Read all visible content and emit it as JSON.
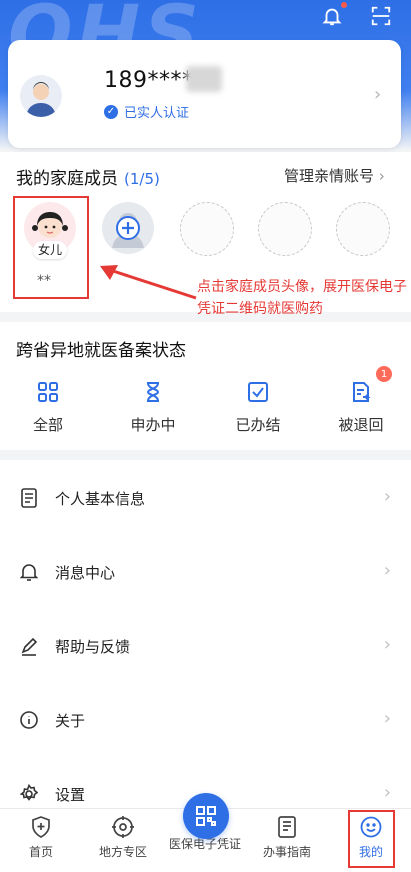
{
  "header": {
    "logo_text": "QHS"
  },
  "top_icons": [
    "bell-icon",
    "scan-icon"
  ],
  "user": {
    "phone": "189****",
    "verify_label": "已实人认证"
  },
  "family": {
    "title": "我的家庭成员",
    "count": "(1/5)",
    "manage_label": "管理亲情账号",
    "member_tag": "女儿",
    "member_name": "**"
  },
  "annotation": "点击家庭成员头像，展开医保电子凭证二维码就医购药",
  "records": {
    "title": "跨省异地就医备案状态",
    "items": [
      "全部",
      "申办中",
      "已办结",
      "被退回"
    ],
    "badge": "1"
  },
  "menu": {
    "items": [
      "个人基本信息",
      "消息中心",
      "帮助与反馈",
      "关于",
      "设置"
    ]
  },
  "nav": {
    "items": [
      "首页",
      "地方专区",
      "医保电子凭证",
      "办事指南",
      "我的"
    ]
  },
  "colors": {
    "primary": "#2f6fe6",
    "annotation": "#e53935",
    "badge": "#ff6b5a"
  }
}
